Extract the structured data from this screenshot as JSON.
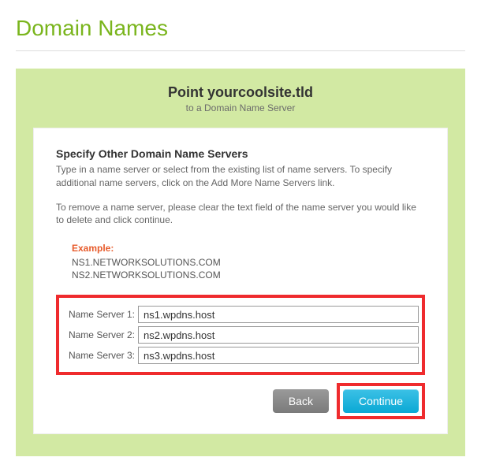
{
  "page": {
    "title": "Domain Names"
  },
  "panel": {
    "title": "Point yourcoolsite.tld",
    "subtitle": "to a Domain Name Server"
  },
  "section": {
    "heading": "Specify Other Domain Name Servers",
    "description": "Type in a name server or select from the existing list of name servers. To specify additional name servers, click on the Add More Name Servers link.",
    "note": "To remove a name server, please clear the text field of the name server you would like to delete and click continue."
  },
  "example": {
    "label": "Example:",
    "lines": [
      "NS1.NETWORKSOLUTIONS.COM",
      "NS2.NETWORKSOLUTIONS.COM"
    ]
  },
  "nameservers": [
    {
      "label": "Name Server 1:",
      "value": "ns1.wpdns.host"
    },
    {
      "label": "Name Server 2:",
      "value": "ns2.wpdns.host"
    },
    {
      "label": "Name Server 3:",
      "value": "ns3.wpdns.host"
    }
  ],
  "buttons": {
    "back": "Back",
    "continue": "Continue"
  }
}
